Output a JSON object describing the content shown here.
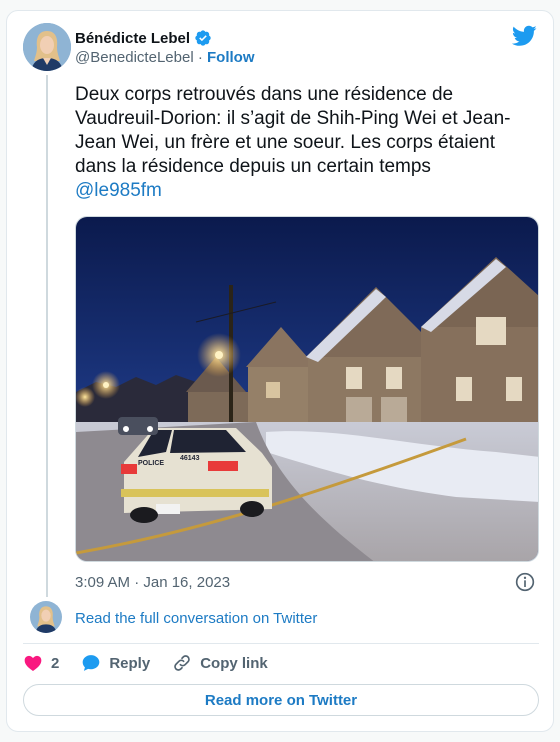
{
  "author": {
    "name": "Bénédicte Lebel",
    "handle": "@BenedicteLebel",
    "separator": "·",
    "follow_label": "Follow",
    "verified": true
  },
  "tweet": {
    "text": "Deux corps retrouvés dans une résidence de Vaudreuil-Dorion: il s’agit de Shih-Ping Wei et Jean-Jean Wei, un frère et une soeur. Les corps étaient dans la résidence depuis un certain temps",
    "mention": "@le985fm",
    "timestamp": "3:09 AM · Jan 16, 2023"
  },
  "photo": {
    "alt": "Maison enneigée la nuit avec une voiture de police et un ruban de police",
    "police_car_text": "POLICE",
    "police_car_number": "46143"
  },
  "conversation": {
    "label": "Read the full conversation on Twitter"
  },
  "actions": {
    "like_count": "2",
    "reply_label": "Reply",
    "copy_link_label": "Copy link"
  },
  "footer": {
    "read_more_label": "Read more on Twitter"
  },
  "colors": {
    "link": "#1d7bc4",
    "like": "#f91880",
    "reply": "#1d9bf0",
    "twitter_blue": "#1d9bf0"
  }
}
